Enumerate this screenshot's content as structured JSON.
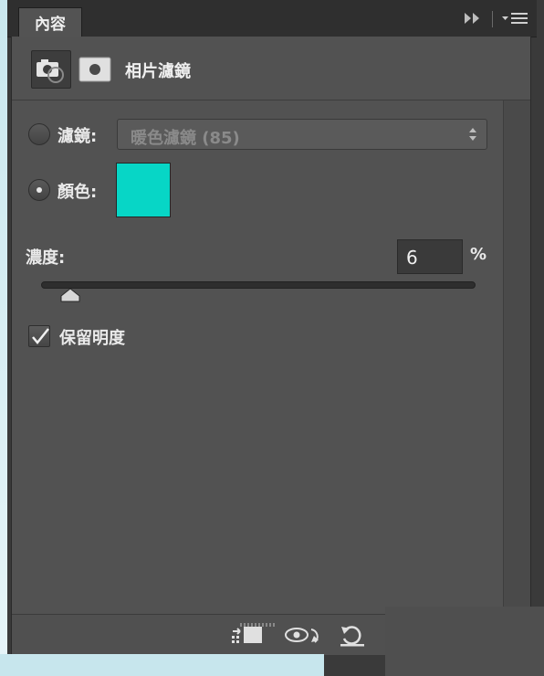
{
  "tab": {
    "label": "內容"
  },
  "panel": {
    "title": "相片濾鏡",
    "icons": [
      "camera-adjustment-icon",
      "layer-mask-icon"
    ]
  },
  "filter_option": {
    "label": "濾鏡:",
    "selected": false,
    "dropdown_value": "暖色濾鏡 (85)"
  },
  "color_option": {
    "label": "顏色:",
    "selected": true,
    "swatch_color": "#07d6c6"
  },
  "density": {
    "label": "濃度:",
    "value": "6",
    "unit": "%",
    "slider_fraction": 0.06
  },
  "preserve_luminosity": {
    "label": "保留明度",
    "checked": true
  },
  "footer": {
    "icons": [
      "clip-to-layer-icon",
      "view-previous-state-icon",
      "reset-icon"
    ]
  }
}
